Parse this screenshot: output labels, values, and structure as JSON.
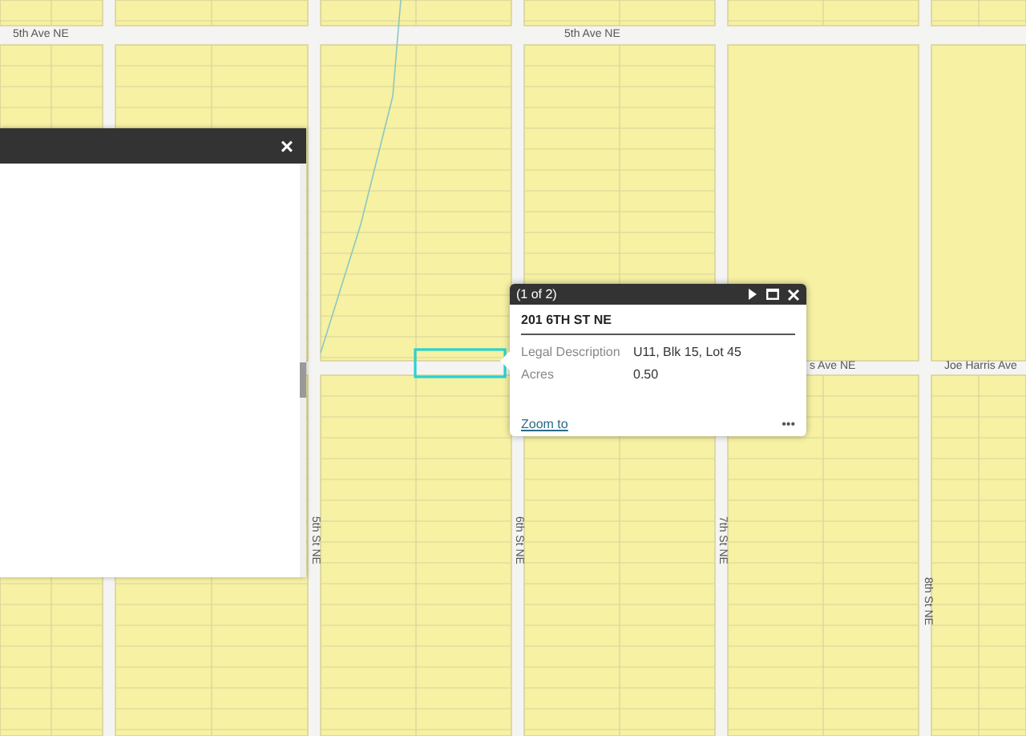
{
  "streets": [
    {
      "name": "5th Ave NE",
      "kind": "horizontal"
    },
    {
      "name": "5th Ave NE",
      "kind": "horizontal"
    },
    {
      "name": "s Ave NE",
      "kind": "horizontal"
    },
    {
      "name": "Joe Harris Ave",
      "kind": "horizontal"
    },
    {
      "name": "5th St NE",
      "kind": "vertical"
    },
    {
      "name": "6th St NE",
      "kind": "vertical"
    },
    {
      "name": "7th St NE",
      "kind": "vertical"
    },
    {
      "name": "8th St NE",
      "kind": "vertical"
    }
  ],
  "side_panel": {
    "close": "×"
  },
  "popup": {
    "counter": "(1 of 2)",
    "title": "201 6TH ST NE",
    "fields": [
      {
        "label": "Legal Description",
        "value": "U11, Blk 15, Lot 45"
      },
      {
        "label": "Acres",
        "value": "0.50"
      }
    ],
    "link": "Zoom to",
    "more": "•••"
  }
}
